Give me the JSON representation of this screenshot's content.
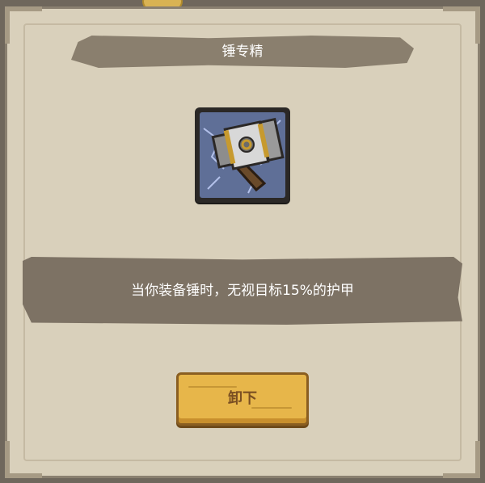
{
  "dialog": {
    "title": "锤专精",
    "description": "当你装备锤时，无视目标15%的护甲",
    "unequip_label": "卸下"
  },
  "item": {
    "icon": "hammer-icon"
  },
  "colors": {
    "panel": "#d9d0bb",
    "title_bar": "#8a7f6e",
    "description_bar": "#7d7264",
    "button": "#e7b64a",
    "button_text": "#7a4f22"
  }
}
